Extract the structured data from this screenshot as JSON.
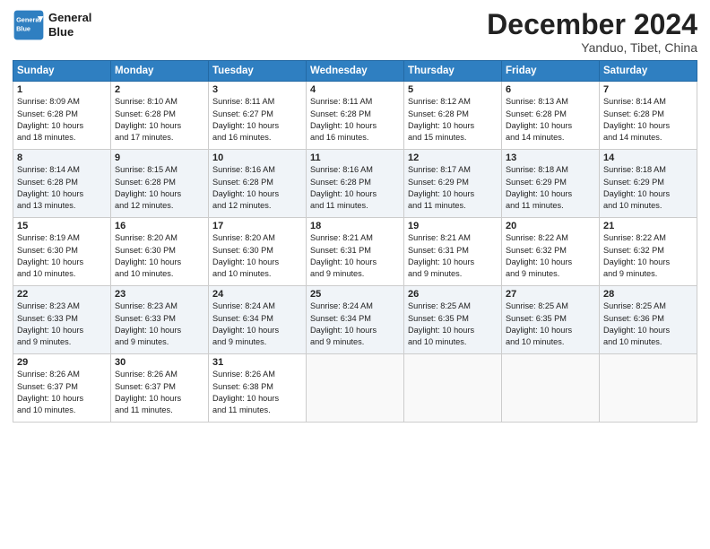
{
  "logo": {
    "line1": "General",
    "line2": "Blue"
  },
  "title": "December 2024",
  "location": "Yanduo, Tibet, China",
  "days_of_week": [
    "Sunday",
    "Monday",
    "Tuesday",
    "Wednesday",
    "Thursday",
    "Friday",
    "Saturday"
  ],
  "weeks": [
    [
      {
        "day": 1,
        "sunrise": "8:09 AM",
        "sunset": "6:28 PM",
        "daylight": "10 hours and 18 minutes."
      },
      {
        "day": 2,
        "sunrise": "8:10 AM",
        "sunset": "6:28 PM",
        "daylight": "10 hours and 17 minutes."
      },
      {
        "day": 3,
        "sunrise": "8:11 AM",
        "sunset": "6:27 PM",
        "daylight": "10 hours and 16 minutes."
      },
      {
        "day": 4,
        "sunrise": "8:11 AM",
        "sunset": "6:28 PM",
        "daylight": "10 hours and 16 minutes."
      },
      {
        "day": 5,
        "sunrise": "8:12 AM",
        "sunset": "6:28 PM",
        "daylight": "10 hours and 15 minutes."
      },
      {
        "day": 6,
        "sunrise": "8:13 AM",
        "sunset": "6:28 PM",
        "daylight": "10 hours and 14 minutes."
      },
      {
        "day": 7,
        "sunrise": "8:14 AM",
        "sunset": "6:28 PM",
        "daylight": "10 hours and 14 minutes."
      }
    ],
    [
      {
        "day": 8,
        "sunrise": "8:14 AM",
        "sunset": "6:28 PM",
        "daylight": "10 hours and 13 minutes."
      },
      {
        "day": 9,
        "sunrise": "8:15 AM",
        "sunset": "6:28 PM",
        "daylight": "10 hours and 12 minutes."
      },
      {
        "day": 10,
        "sunrise": "8:16 AM",
        "sunset": "6:28 PM",
        "daylight": "10 hours and 12 minutes."
      },
      {
        "day": 11,
        "sunrise": "8:16 AM",
        "sunset": "6:28 PM",
        "daylight": "10 hours and 11 minutes."
      },
      {
        "day": 12,
        "sunrise": "8:17 AM",
        "sunset": "6:29 PM",
        "daylight": "10 hours and 11 minutes."
      },
      {
        "day": 13,
        "sunrise": "8:18 AM",
        "sunset": "6:29 PM",
        "daylight": "10 hours and 11 minutes."
      },
      {
        "day": 14,
        "sunrise": "8:18 AM",
        "sunset": "6:29 PM",
        "daylight": "10 hours and 10 minutes."
      }
    ],
    [
      {
        "day": 15,
        "sunrise": "8:19 AM",
        "sunset": "6:30 PM",
        "daylight": "10 hours and 10 minutes."
      },
      {
        "day": 16,
        "sunrise": "8:20 AM",
        "sunset": "6:30 PM",
        "daylight": "10 hours and 10 minutes."
      },
      {
        "day": 17,
        "sunrise": "8:20 AM",
        "sunset": "6:30 PM",
        "daylight": "10 hours and 10 minutes."
      },
      {
        "day": 18,
        "sunrise": "8:21 AM",
        "sunset": "6:31 PM",
        "daylight": "10 hours and 9 minutes."
      },
      {
        "day": 19,
        "sunrise": "8:21 AM",
        "sunset": "6:31 PM",
        "daylight": "10 hours and 9 minutes."
      },
      {
        "day": 20,
        "sunrise": "8:22 AM",
        "sunset": "6:32 PM",
        "daylight": "10 hours and 9 minutes."
      },
      {
        "day": 21,
        "sunrise": "8:22 AM",
        "sunset": "6:32 PM",
        "daylight": "10 hours and 9 minutes."
      }
    ],
    [
      {
        "day": 22,
        "sunrise": "8:23 AM",
        "sunset": "6:33 PM",
        "daylight": "10 hours and 9 minutes."
      },
      {
        "day": 23,
        "sunrise": "8:23 AM",
        "sunset": "6:33 PM",
        "daylight": "10 hours and 9 minutes."
      },
      {
        "day": 24,
        "sunrise": "8:24 AM",
        "sunset": "6:34 PM",
        "daylight": "10 hours and 9 minutes."
      },
      {
        "day": 25,
        "sunrise": "8:24 AM",
        "sunset": "6:34 PM",
        "daylight": "10 hours and 9 minutes."
      },
      {
        "day": 26,
        "sunrise": "8:25 AM",
        "sunset": "6:35 PM",
        "daylight": "10 hours and 10 minutes."
      },
      {
        "day": 27,
        "sunrise": "8:25 AM",
        "sunset": "6:35 PM",
        "daylight": "10 hours and 10 minutes."
      },
      {
        "day": 28,
        "sunrise": "8:25 AM",
        "sunset": "6:36 PM",
        "daylight": "10 hours and 10 minutes."
      }
    ],
    [
      {
        "day": 29,
        "sunrise": "8:26 AM",
        "sunset": "6:37 PM",
        "daylight": "10 hours and 10 minutes."
      },
      {
        "day": 30,
        "sunrise": "8:26 AM",
        "sunset": "6:37 PM",
        "daylight": "10 hours and 11 minutes."
      },
      {
        "day": 31,
        "sunrise": "8:26 AM",
        "sunset": "6:38 PM",
        "daylight": "10 hours and 11 minutes."
      },
      null,
      null,
      null,
      null
    ]
  ],
  "labels": {
    "sunrise": "Sunrise:",
    "sunset": "Sunset:",
    "daylight": "Daylight:"
  }
}
